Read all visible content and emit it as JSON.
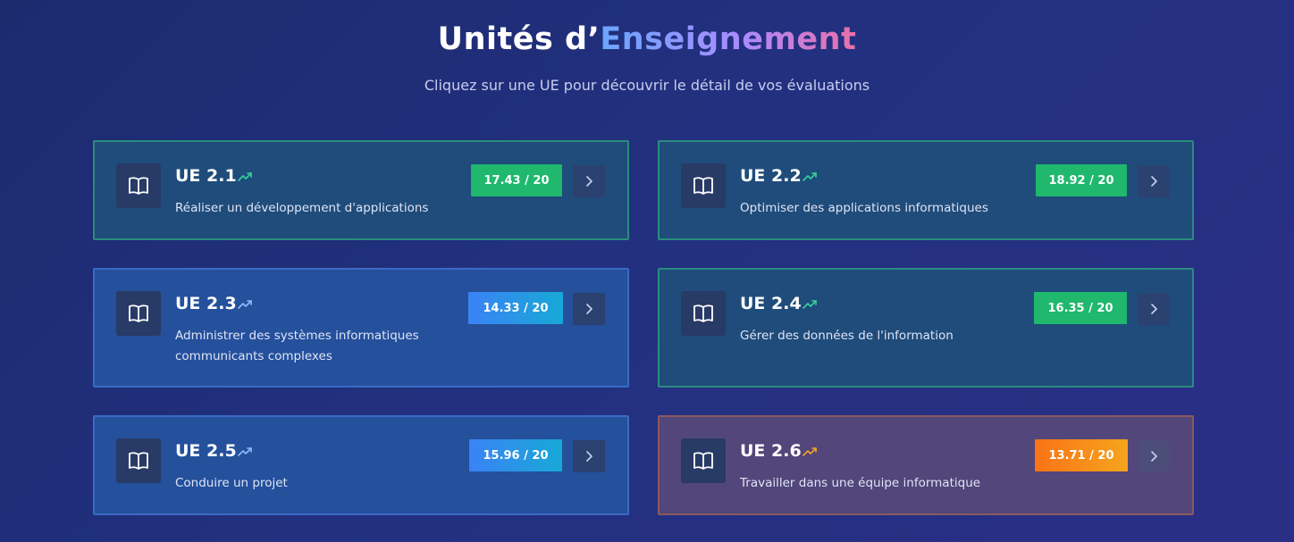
{
  "header": {
    "title_part1": "Unités d’",
    "title_part2": "Enseignement",
    "subtitle": "Cliquez sur une UE pour découvrir le détail de vos évaluations"
  },
  "colors": {
    "green": "#1fb86d",
    "blue": "#3b82f6",
    "orange": "#f97316",
    "trend_green": "#34d399",
    "trend_blue": "#93b8ff",
    "trend_orange": "#f5a51d"
  },
  "units": [
    {
      "code": "UE 2.1",
      "title": "Réaliser un développement d'applications",
      "grade": "17.43 / 20",
      "status": "green",
      "icon": "book-icon",
      "trend_icon": "trend-up-icon",
      "chevron_icon": "chevron-right-icon"
    },
    {
      "code": "UE 2.2",
      "title": "Optimiser des applications informatiques",
      "grade": "18.92 / 20",
      "status": "green",
      "icon": "book-icon",
      "trend_icon": "trend-up-icon",
      "chevron_icon": "chevron-right-icon"
    },
    {
      "code": "UE 2.3",
      "title": "Administrer des systèmes informatiques communicants complexes",
      "grade": "14.33 / 20",
      "status": "blue",
      "icon": "book-icon",
      "trend_icon": "trend-up-icon",
      "chevron_icon": "chevron-right-icon"
    },
    {
      "code": "UE 2.4",
      "title": "Gérer des données de l'information",
      "grade": "16.35 / 20",
      "status": "green",
      "icon": "book-icon",
      "trend_icon": "trend-up-icon",
      "chevron_icon": "chevron-right-icon"
    },
    {
      "code": "UE 2.5",
      "title": "Conduire un projet",
      "grade": "15.96 / 20",
      "status": "blue",
      "icon": "book-icon",
      "trend_icon": "trend-up-icon",
      "chevron_icon": "chevron-right-icon"
    },
    {
      "code": "UE 2.6",
      "title": "Travailler dans une équipe informatique",
      "grade": "13.71 / 20",
      "status": "orange",
      "icon": "book-icon",
      "trend_icon": "trend-up-icon",
      "chevron_icon": "chevron-right-icon"
    }
  ]
}
